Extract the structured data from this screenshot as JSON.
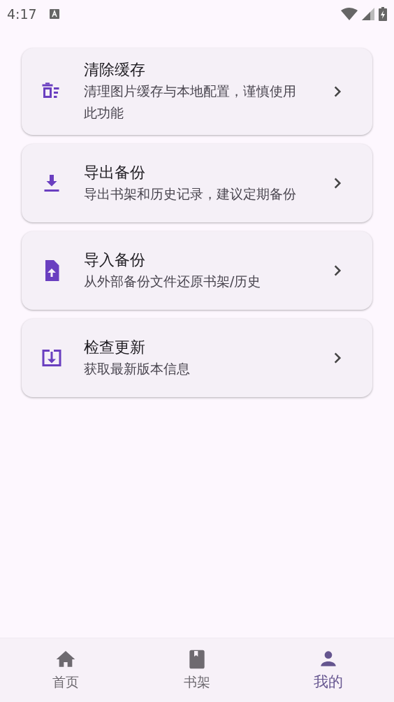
{
  "status_bar": {
    "time": "4:17"
  },
  "items": [
    {
      "kind": "clear",
      "title": "清除缓存",
      "subtitle": "清理图片缓存与本地配置，谨慎使用此功能"
    },
    {
      "kind": "export",
      "title": "导出备份",
      "subtitle": "导出书架和历史记录，建议定期备份"
    },
    {
      "kind": "import",
      "title": "导入备份",
      "subtitle": "从外部备份文件还原书架/历史"
    },
    {
      "kind": "update",
      "title": "检查更新",
      "subtitle": "获取最新版本信息"
    }
  ],
  "nav": [
    {
      "kind": "home",
      "label": "首页",
      "selected": false
    },
    {
      "kind": "shelf",
      "label": "书架",
      "selected": false
    },
    {
      "kind": "me",
      "label": "我的",
      "selected": true
    }
  ]
}
